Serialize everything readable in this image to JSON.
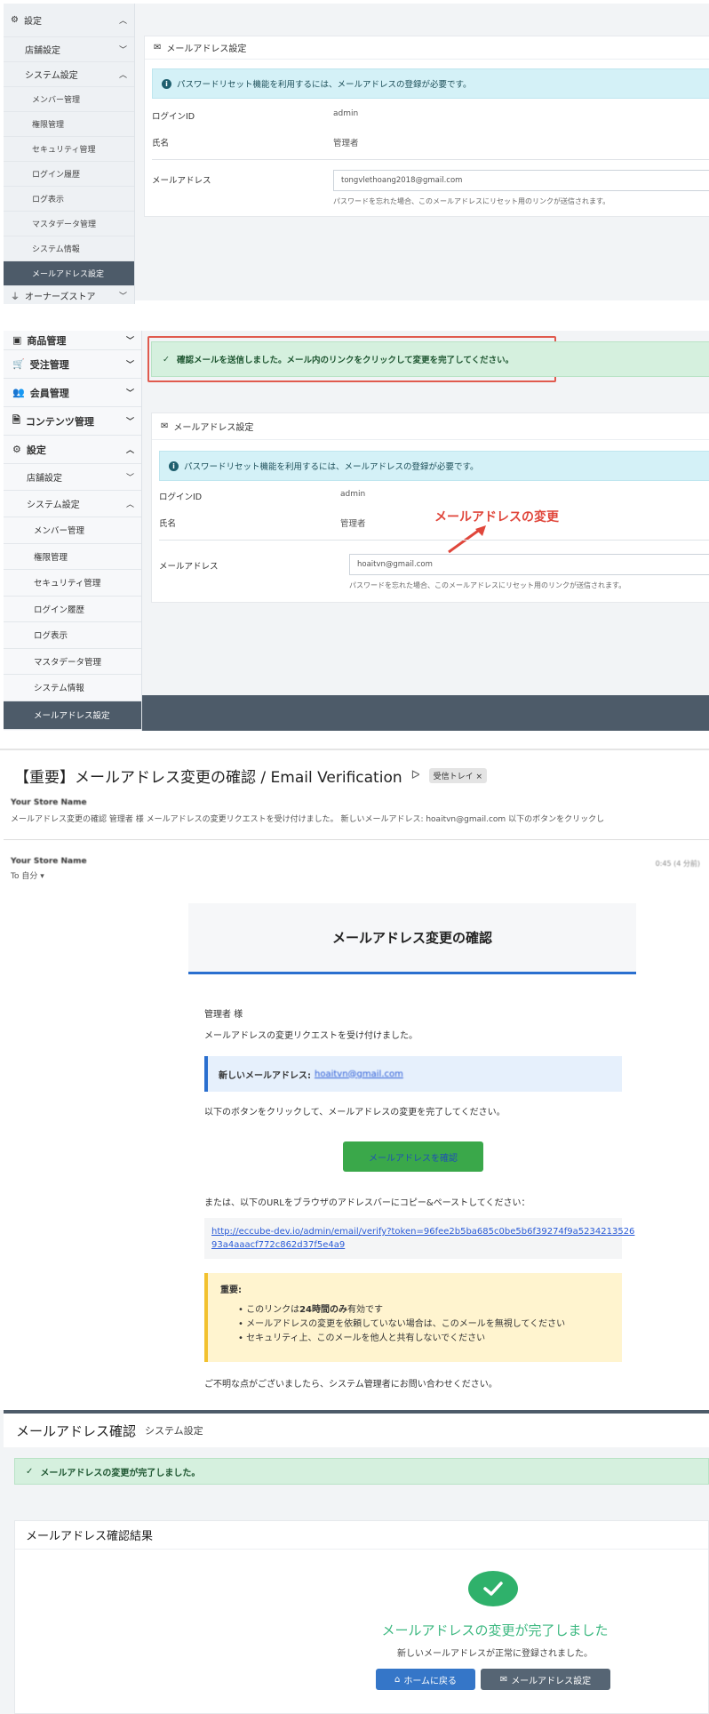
{
  "panel1": {
    "sidebar": {
      "settings": "設定",
      "store_settings": "店舗設定",
      "system_settings": "システム設定",
      "items": [
        "メンバー管理",
        "権限管理",
        "セキュリティ管理",
        "ログイン履歴",
        "ログ表示",
        "マスタデータ管理",
        "システム情報",
        "メールアドレス設定"
      ],
      "owners_store": "オーナーズストア"
    },
    "card_title": "メールアドレス設定",
    "info": "パスワードリセット機能を利用するには、メールアドレスの登録が必要です。",
    "login_id_label": "ログインID",
    "login_id_value": "admin",
    "name_label": "氏名",
    "name_value": "管理者",
    "email_label": "メールアドレス",
    "email_value": "tongvlethoang2018@gmail.com",
    "help": "パスワードを忘れた場合、このメールアドレスにリセット用のリンクが送信されます。"
  },
  "panel2": {
    "sidebar": {
      "products": "商品管理",
      "orders": "受注管理",
      "members": "会員管理",
      "contents": "コンテンツ管理",
      "settings": "設定",
      "store_settings": "店舗設定",
      "system_settings": "システム設定",
      "items": [
        "メンバー管理",
        "権限管理",
        "セキュリティ管理",
        "ログイン履歴",
        "ログ表示",
        "マスタデータ管理",
        "システム情報",
        "メールアドレス設定"
      ]
    },
    "alert": "確認メールを送信しました。メール内のリンクをクリックして変更を完了してください。",
    "card_title": "メールアドレス設定",
    "info": "パスワードリセット機能を利用するには、メールアドレスの登録が必要です。",
    "login_id_label": "ログインID",
    "login_id_value": "admin",
    "name_label": "氏名",
    "name_value": "管理者",
    "email_label": "メールアドレス",
    "email_value": "hoaitvn@gmail.com",
    "help": "パスワードを忘れた場合、このメールアドレスにリセット用のリンクが送信されます。",
    "annotation": "メールアドレスの変更"
  },
  "email": {
    "subject": "【重要】メールアドレス変更の確認 / Email Verification",
    "inbox_tag": "受信トレイ",
    "sender": "Your Store Name",
    "snippet": "メールアドレス変更の確認 管理者 様 メールアドレスの変更リクエストを受け付けました。 新しいメールアドレス: hoaitvn@gmail.com 以下のボタンをクリックし",
    "sender2": "Your Store Name",
    "to": "To 自分",
    "time": "0:45 (4 分前)",
    "heading": "メールアドレス変更の確認",
    "greeting": "管理者 様",
    "line1": "メールアドレスの変更リクエストを受け付けました。",
    "new_email_label": "新しいメールアドレス:",
    "new_email_value": "hoaitvn@gmail.com",
    "line2": "以下のボタンをクリックして、メールアドレスの変更を完了してください。",
    "button": "メールアドレスを確認",
    "line3": "または、以下のURLをブラウザのアドレスバーにコピー&ペーストしてください：",
    "url1": "http://eccube-dev.io/admin/email/verify?token=96fee2b5ba685c0be5b6f39274f9a5234213526",
    "url2": "93a4aaacf772c862d37f5e4a9",
    "important_title": "重要:",
    "bullet1_a": "このリンクは",
    "bullet1_b": "24時間のみ",
    "bullet1_c": "有効です",
    "bullet2": "メールアドレスの変更を依頼していない場合は、このメールを無視してください",
    "bullet3": "セキュリティ上、このメールを他人と共有しないでください",
    "footer": "ご不明な点がございましたら、システム管理者にお問い合わせください。"
  },
  "panel4": {
    "title": "メールアドレス確認",
    "subtitle": "システム設定",
    "alert": "メールアドレスの変更が完了しました。",
    "card_title": "メールアドレス確認結果",
    "done_title": "メールアドレスの変更が完了しました",
    "done_sub": "新しいメールアドレスが正常に登録されました。",
    "home_button": "ホームに戻る",
    "settings_button": "メールアドレス設定"
  }
}
